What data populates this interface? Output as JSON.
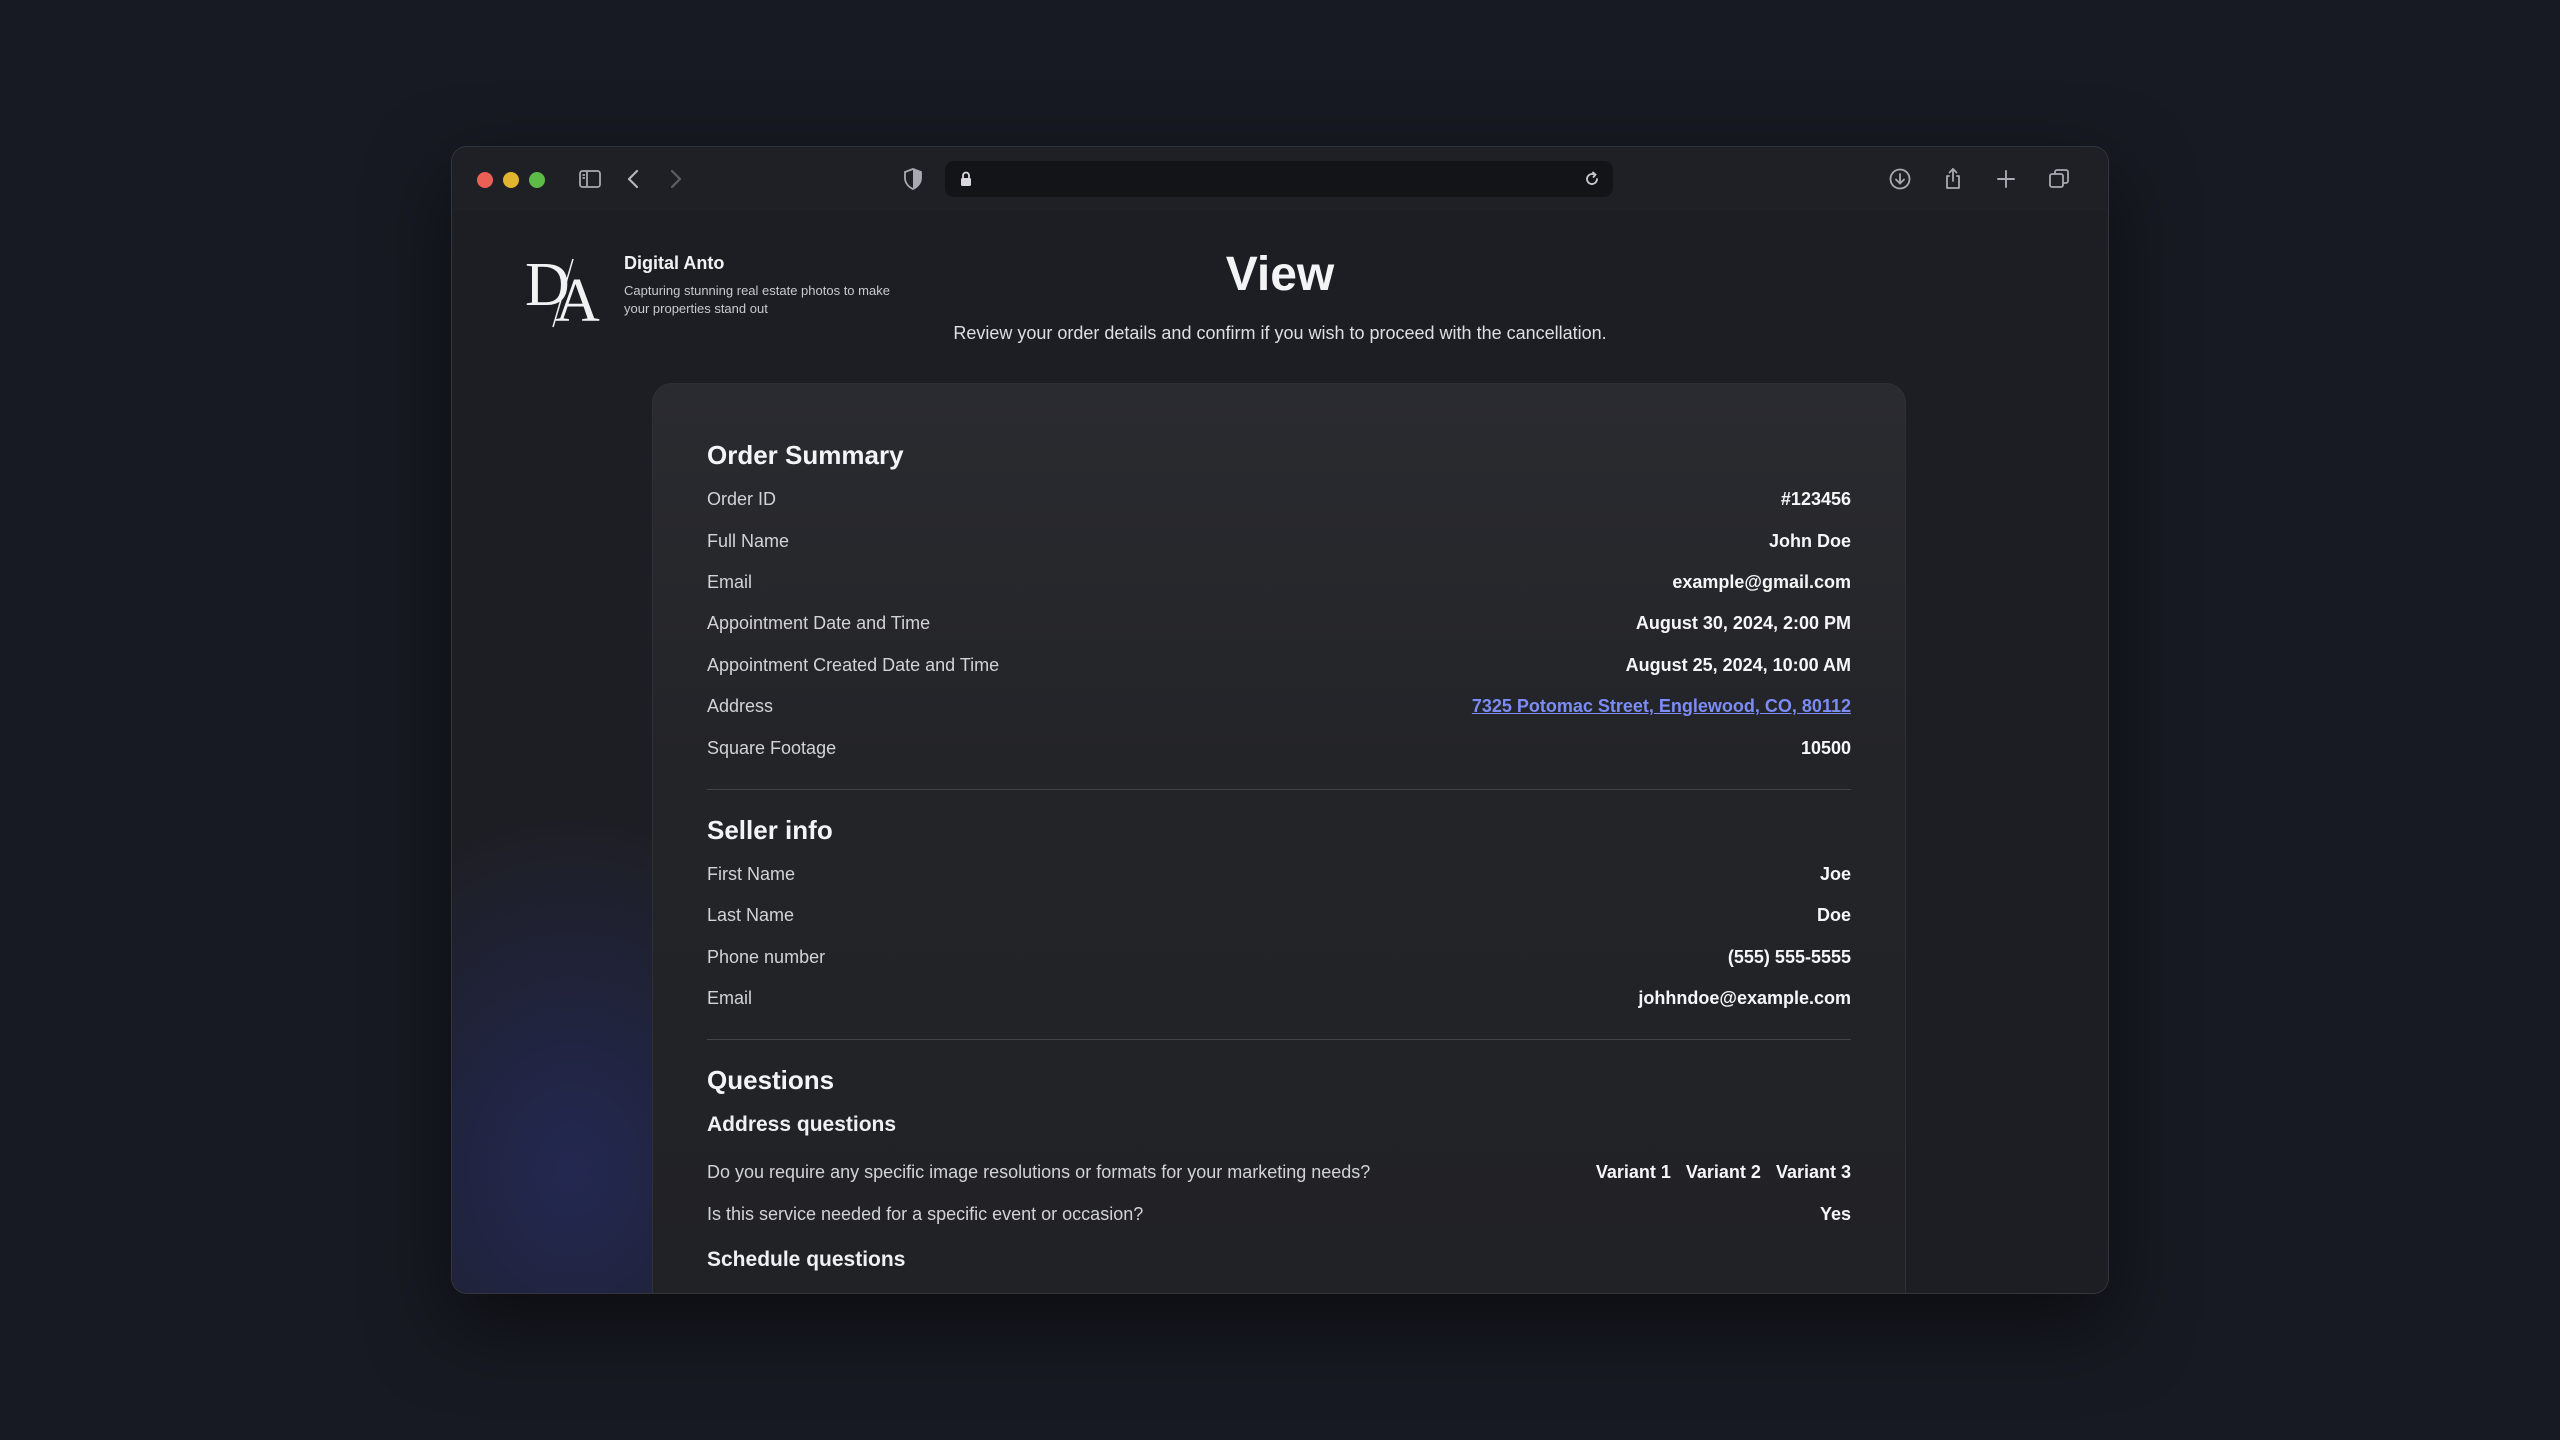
{
  "browser": {
    "url": ""
  },
  "brand": {
    "name": "Digital Anto",
    "tagline": "Capturing stunning real estate photos to make your properties stand out"
  },
  "page": {
    "title": "View",
    "subtitle": "Review your order details and confirm if you wish to proceed with the cancellation."
  },
  "order_summary": {
    "title": "Order Summary",
    "rows": [
      {
        "label": "Order ID",
        "value": "#123456"
      },
      {
        "label": "Full Name",
        "value": "John Doe"
      },
      {
        "label": "Email",
        "value": "example@gmail.com"
      },
      {
        "label": "Appointment Date and Time",
        "value": "August 30, 2024, 2:00 PM"
      },
      {
        "label": "Appointment Created Date and Time",
        "value": "August 25, 2024, 10:00 AM"
      },
      {
        "label": "Address",
        "value": "7325 Potomac Street, Englewood, CO, 80112"
      },
      {
        "label": "Square Footage",
        "value": "10500"
      }
    ]
  },
  "seller_info": {
    "title": "Seller info",
    "rows": [
      {
        "label": "First Name",
        "value": "Joe"
      },
      {
        "label": "Last Name",
        "value": "Doe"
      },
      {
        "label": "Phone number",
        "value": "(555) 555-5555"
      },
      {
        "label": "Email",
        "value": "johhndoe@example.com"
      }
    ]
  },
  "questions": {
    "title": "Questions",
    "address_questions": {
      "title": "Address questions",
      "q1": {
        "label": "Do you require any specific image resolutions or formats for your marketing needs?",
        "values": [
          "Variant 1",
          "Variant 2",
          "Variant 3"
        ]
      },
      "q2": {
        "label": "Is this service needed for a specific event or occasion?",
        "value": "Yes"
      }
    },
    "schedule_questions": {
      "title": "Schedule questions"
    }
  },
  "colors": {
    "link": "#7b8cf6",
    "traffic_red": "#ec5f57",
    "traffic_yellow": "#e1b530",
    "traffic_green": "#5dbb48"
  }
}
